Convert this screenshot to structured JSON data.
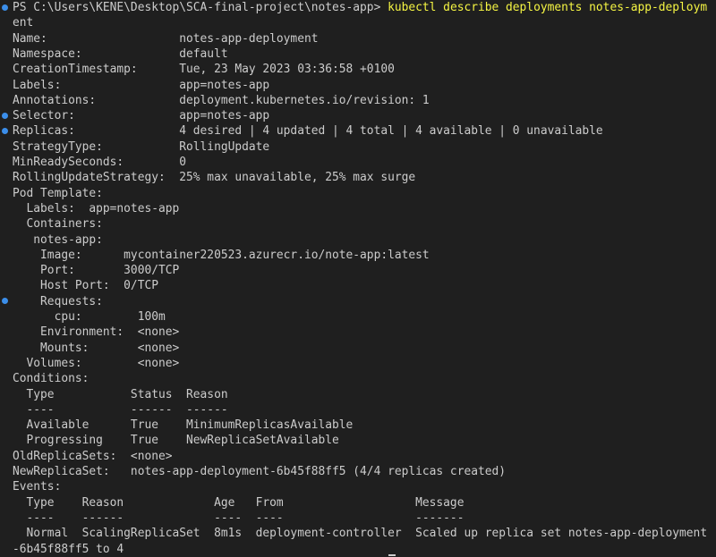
{
  "terminal": {
    "prompt": "PS C:\\Users\\KENE\\Desktop\\SCA-final-project\\notes-app> ",
    "command": "kubectl describe deployments notes-app-deploym",
    "lines": [
      "ent",
      "Name:                   notes-app-deployment",
      "Namespace:              default",
      "CreationTimestamp:      Tue, 23 May 2023 03:36:58 +0100",
      "Labels:                 app=notes-app",
      "Annotations:            deployment.kubernetes.io/revision: 1",
      "Selector:               app=notes-app",
      "Replicas:               4 desired | 4 updated | 4 total | 4 available | 0 unavailable",
      "StrategyType:           RollingUpdate",
      "MinReadySeconds:        0",
      "RollingUpdateStrategy:  25% max unavailable, 25% max surge",
      "Pod Template:",
      "  Labels:  app=notes-app",
      "  Containers:",
      "   notes-app:",
      "    Image:      mycontainer220523.azurecr.io/note-app:latest",
      "    Port:       3000/TCP",
      "    Host Port:  0/TCP",
      "    Requests:",
      "      cpu:        100m",
      "    Environment:  <none>",
      "    Mounts:       <none>",
      "  Volumes:        <none>",
      "Conditions:",
      "  Type           Status  Reason",
      "  ----           ------  ------",
      "  Available      True    MinimumReplicasAvailable",
      "  Progressing    True    NewReplicaSetAvailable",
      "OldReplicaSets:  <none>",
      "NewReplicaSet:   notes-app-deployment-6b45f88ff5 (4/4 replicas created)",
      "Events:",
      "  Type    Reason             Age   From                   Message",
      "  ----    ------             ----  ----                   -------",
      "  Normal  ScalingReplicaSet  8m1s  deployment-controller  Scaled up replica set notes-app-deployment",
      "-6b45f88ff5 to 4"
    ]
  }
}
